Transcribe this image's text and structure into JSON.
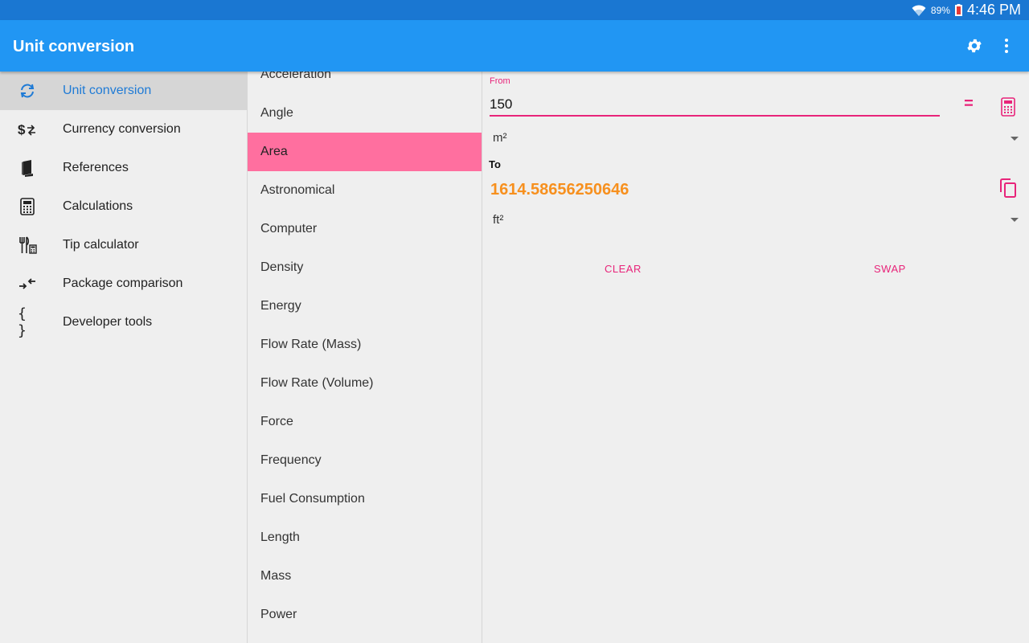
{
  "status_bar": {
    "battery_percent": "89%",
    "time": "4:46 PM"
  },
  "app_bar": {
    "title": "Unit conversion"
  },
  "drawer": {
    "items": [
      {
        "label": "Unit conversion",
        "icon": "sync-icon",
        "active": true
      },
      {
        "label": "Currency conversion",
        "icon": "currency-exchange-icon"
      },
      {
        "label": "References",
        "icon": "book-icon"
      },
      {
        "label": "Calculations",
        "icon": "calculator-icon"
      },
      {
        "label": "Tip calculator",
        "icon": "restaurant-calculator-icon"
      },
      {
        "label": "Package comparison",
        "icon": "compare-arrows-icon"
      },
      {
        "label": "Developer tools",
        "icon": "code-braces-icon"
      }
    ]
  },
  "categories": {
    "selected": "Area",
    "items": [
      "Acceleration",
      "Angle",
      "Area",
      "Astronomical",
      "Computer",
      "Density",
      "Energy",
      "Flow Rate (Mass)",
      "Flow Rate (Volume)",
      "Force",
      "Frequency",
      "Fuel Consumption",
      "Length",
      "Mass",
      "Power"
    ]
  },
  "converter": {
    "from_label": "From",
    "from_value": "150",
    "from_unit": "m²",
    "to_label": "To",
    "result": "1614.58656250646",
    "to_unit": "ft²",
    "equals": "=",
    "clear_label": "CLEAR",
    "swap_label": "SWAP"
  },
  "colors": {
    "status_bar": "#1a77d2",
    "app_bar": "#2196f3",
    "accent_pink": "#e8247a",
    "selected_category": "#ff6f9f",
    "result_orange": "#f7901e",
    "active_nav": "#1f7bd6"
  }
}
